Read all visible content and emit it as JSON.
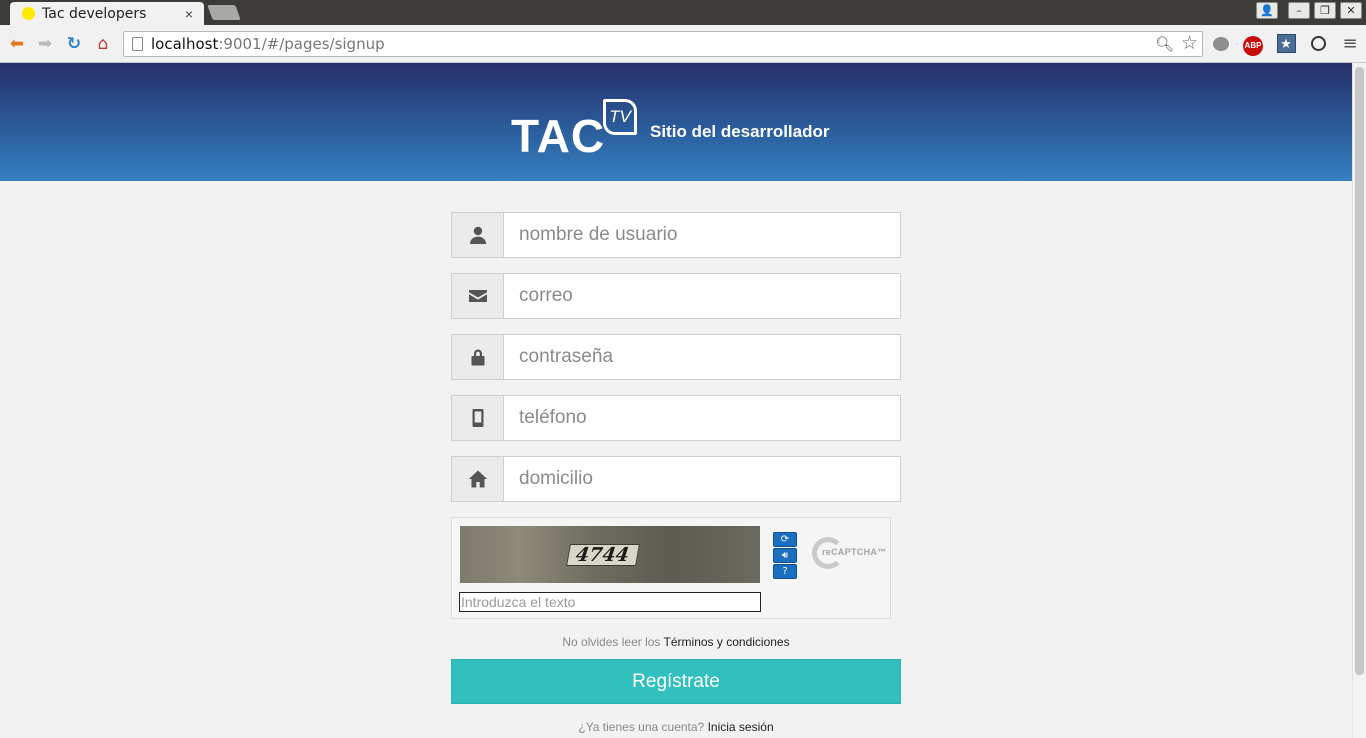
{
  "browser": {
    "tab_title": "Tac developers",
    "tab_close": "×",
    "url_host": "localhost",
    "url_rest": ":9001/#/pages/signup",
    "window_buttons": {
      "user": "👤",
      "minimize": "–",
      "restore": "❐",
      "close": "✕"
    },
    "toolbar_icons": {
      "back": "arrow-left-icon",
      "forward": "arrow-right-icon",
      "reload": "reload-icon",
      "home": "home-icon",
      "zoom": "magnifier-icon",
      "bookmark": "star-icon",
      "menu": "hamburger-icon"
    },
    "extensions": {
      "abp_label": "ABP",
      "bookmark_star": "★"
    }
  },
  "header": {
    "logo_text": "TAC",
    "logo_badge": "TV",
    "site_name": "Sitio del desarrollador",
    "gradient_top": "#272f6a",
    "gradient_bottom": "#3480c1"
  },
  "form": {
    "fields": [
      {
        "icon": "user-icon",
        "placeholder": "nombre de usuario"
      },
      {
        "icon": "envelope-icon",
        "placeholder": "correo"
      },
      {
        "icon": "lock-icon",
        "placeholder": "contraseña"
      },
      {
        "icon": "mobile-phone-icon",
        "placeholder": "teléfono"
      },
      {
        "icon": "home-icon",
        "placeholder": "domicilio"
      }
    ],
    "captcha": {
      "image_text": "4744",
      "input_placeholder": "Introduzca el texto",
      "logo_text": "reCAPTCHA™",
      "buttons": [
        "reload-icon",
        "audio-icon",
        "help-icon"
      ]
    },
    "terms_prefix": "No olvides leer los",
    "terms_link": "Términos y condiciones",
    "submit_label": "Regístrate",
    "submit_color": "#31c0be",
    "login_prefix": "¿Ya tienes una cuenta?",
    "login_link": "Inicia sesión"
  }
}
